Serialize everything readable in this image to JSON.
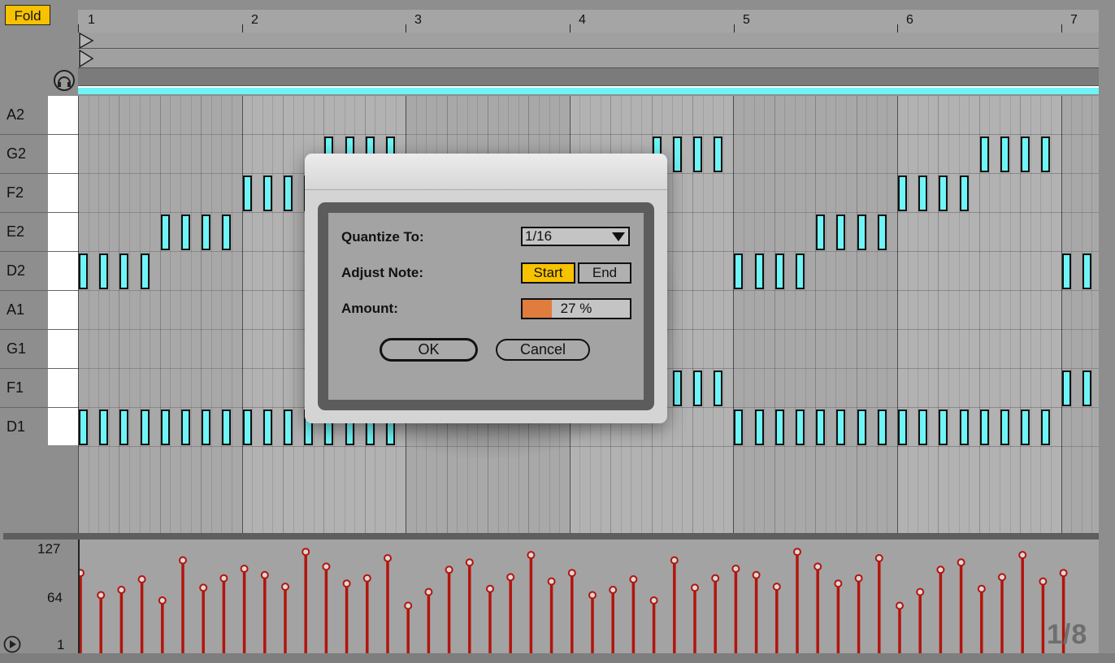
{
  "fold_button": {
    "label": "Fold"
  },
  "ruler": {
    "bars": [
      "1",
      "2",
      "3",
      "4",
      "5",
      "6",
      "7"
    ]
  },
  "piano_rows": [
    "A2",
    "G2",
    "F2",
    "E2",
    "D2",
    "A1",
    "G1",
    "F1",
    "D1"
  ],
  "velocity": {
    "labels": {
      "max": "127",
      "mid": "64",
      "min": "1"
    }
  },
  "grid_size": "1/8",
  "dialog": {
    "quantize_label": "Quantize To:",
    "quantize_value": "1/16",
    "adjust_label": "Adjust Note:",
    "start_label": "Start",
    "end_label": "End",
    "amount_label": "Amount:",
    "amount_value": "27 %",
    "amount_fraction": 0.27,
    "ok_label": "OK",
    "cancel_label": "Cancel"
  },
  "colors": {
    "note": "#6ff5f7",
    "velocity": "#b3140c",
    "selected": "#f7c200",
    "amount_fill": "#e07c3e"
  },
  "icons": {
    "headphones": "headphones-icon",
    "play": "play-icon",
    "dropdown": "chevron-down-icon",
    "fold_marker": "triangle-right-icon"
  }
}
